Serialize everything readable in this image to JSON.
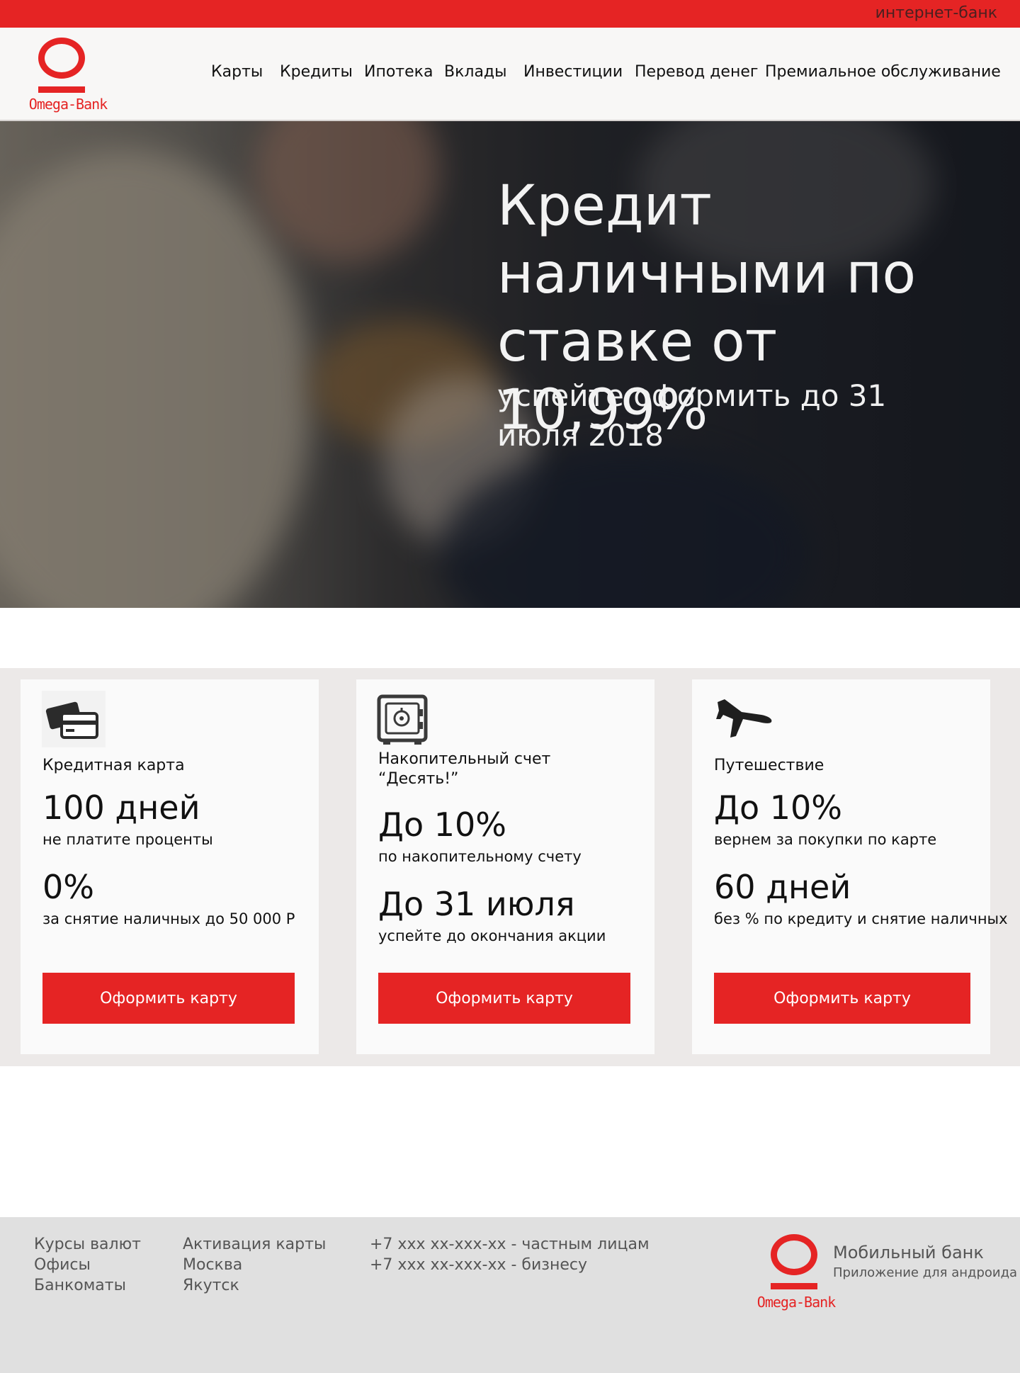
{
  "topbar": {
    "internet_bank": "интернет-банк"
  },
  "header": {
    "logo_text": "Omega-Bank",
    "nav": [
      {
        "label": "Карты"
      },
      {
        "label": "Кредиты"
      },
      {
        "label": "Ипотека"
      },
      {
        "label": "Вклады"
      },
      {
        "label": "Инвестиции"
      },
      {
        "label": "Перевод денег"
      },
      {
        "label": "Премиальное обслуживание"
      }
    ]
  },
  "hero": {
    "title": "Кредит наличными по ставке от 10,99%",
    "subtitle": "успейте оформить до 31 июля 2018"
  },
  "cards": [
    {
      "icon": "credit-cards-icon",
      "title": "Кредитная карта",
      "big1": "100 дней",
      "small1": "не платите проценты",
      "big2": "0%",
      "small2": "за снятие наличных до 50 000 Р",
      "button": "Оформить карту"
    },
    {
      "icon": "safe-icon",
      "title": "Накопительный счет “Десять!”",
      "big1": "До 10%",
      "small1": "по накопительному счету",
      "big2": "До 31 июля",
      "small2": "успейте до окончания акции",
      "button": "Оформить карту"
    },
    {
      "icon": "airplane-icon",
      "title": "Путешествие",
      "big1": "До 10%",
      "small1": "вернем за покупки по карте",
      "big2": "60 дней",
      "small2": "без % по кредиту и снятие наличных",
      "button": "Оформить карту"
    }
  ],
  "footer": {
    "col1": [
      "Курсы валют",
      "Офисы",
      "Банкоматы"
    ],
    "col2": [
      "Активация карты",
      "Москва",
      "Якутск"
    ],
    "col3": [
      "+7 xxx xx-xxx-xx - частным лицам",
      "+7 xxx xx-xxx-xx - бизнесу"
    ],
    "logo_text": "Omega-Bank",
    "mobile_title": "Мобильный банк",
    "mobile_sub": "Приложение для андроида"
  },
  "colors": {
    "brand_red": "#e52424",
    "card_bg": "#fafafa",
    "band_bg": "#ece9e8",
    "footer_bg": "#e0e0e0"
  }
}
